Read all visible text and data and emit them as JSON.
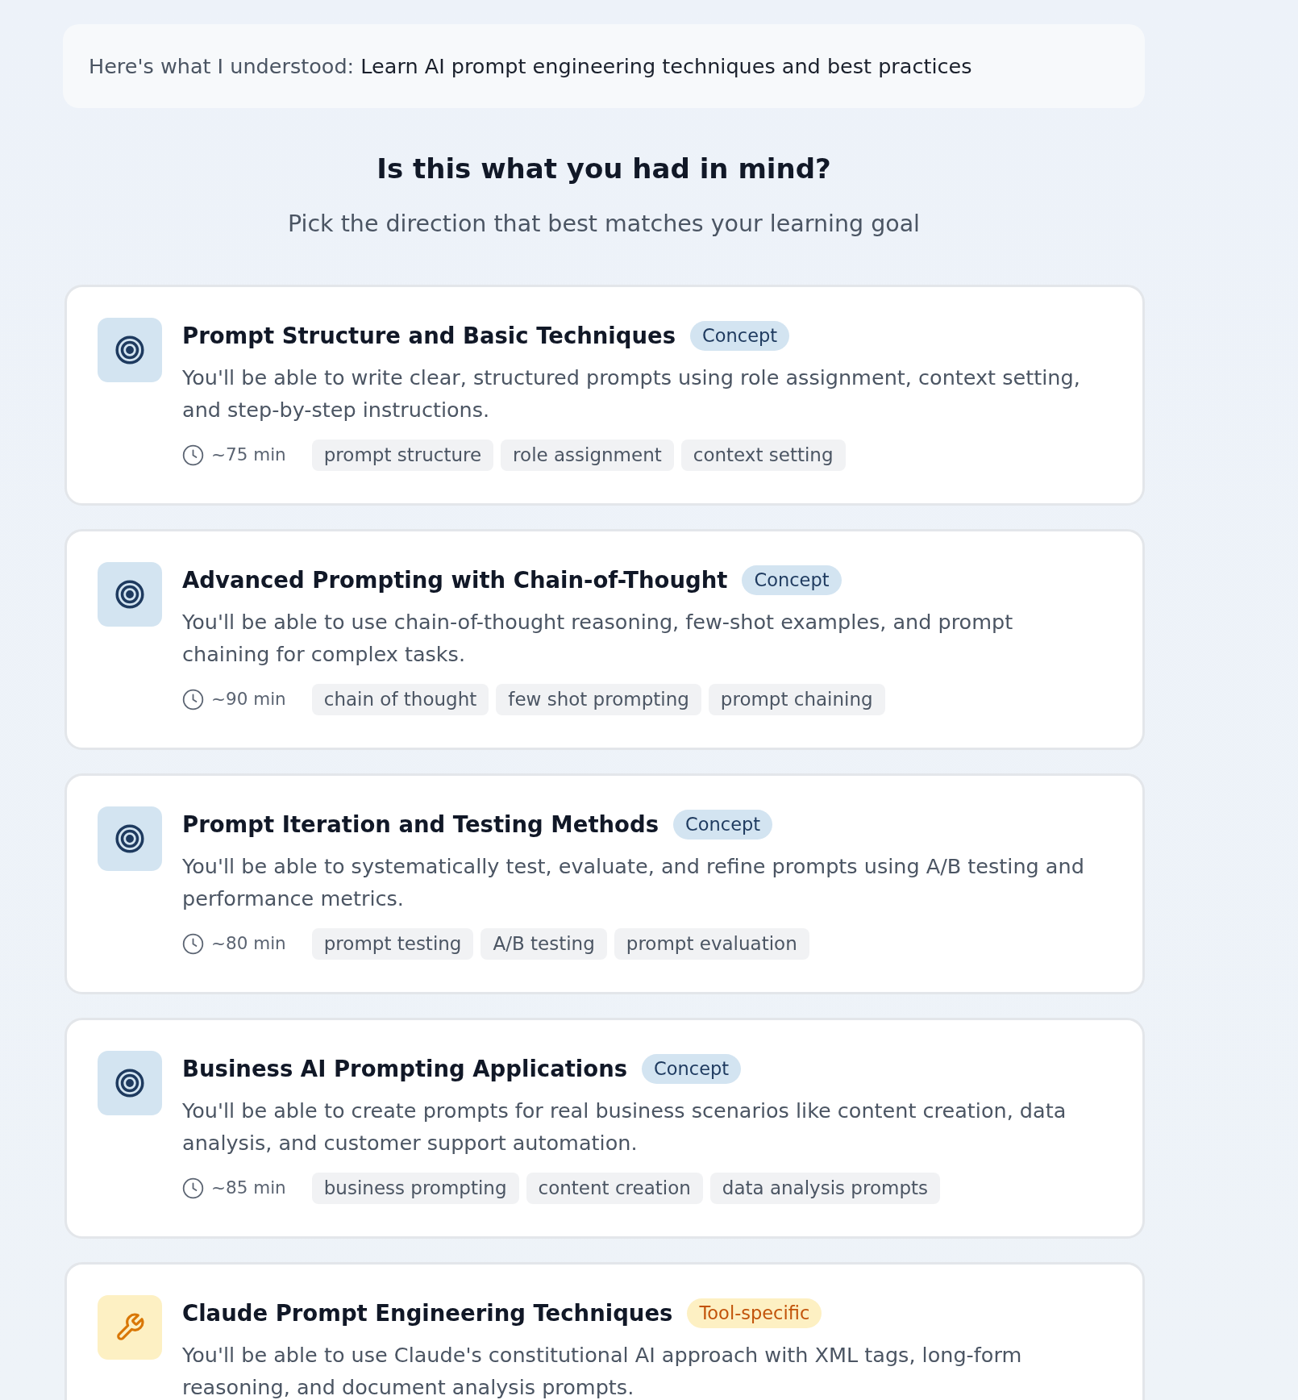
{
  "summary": {
    "label": "Here's what I understood:",
    "text": "Learn AI prompt engineering techniques and best practices"
  },
  "heading": "Is this what you had in mind?",
  "subheading": "Pick the direction that best matches your learning goal",
  "options": [
    {
      "kind": "concept",
      "title": "Prompt Structure and Basic Techniques",
      "badge": "Concept",
      "description": "You'll be able to write clear, structured prompts using role assignment, context setting, and step-by-step instructions.",
      "duration": "~75 min",
      "tags": [
        "prompt structure",
        "role assignment",
        "context setting"
      ]
    },
    {
      "kind": "concept",
      "title": "Advanced Prompting with Chain-of-Thought",
      "badge": "Concept",
      "description": "You'll be able to use chain-of-thought reasoning, few-shot examples, and prompt chaining for complex tasks.",
      "duration": "~90 min",
      "tags": [
        "chain of thought",
        "few shot prompting",
        "prompt chaining"
      ]
    },
    {
      "kind": "concept",
      "title": "Prompt Iteration and Testing Methods",
      "badge": "Concept",
      "description": "You'll be able to systematically test, evaluate, and refine prompts using A/B testing and performance metrics.",
      "duration": "~80 min",
      "tags": [
        "prompt testing",
        "A/B testing",
        "prompt evaluation"
      ]
    },
    {
      "kind": "concept",
      "title": "Business AI Prompting Applications",
      "badge": "Concept",
      "description": "You'll be able to create prompts for real business scenarios like content creation, data analysis, and customer support automation.",
      "duration": "~85 min",
      "tags": [
        "business prompting",
        "content creation",
        "data analysis prompts"
      ]
    },
    {
      "kind": "tool",
      "title": "Claude Prompt Engineering Techniques",
      "badge": "Tool-specific",
      "description": "You'll be able to use Claude's constitutional AI approach with XML tags, long-form reasoning, and document analysis prompts."
    }
  ]
}
